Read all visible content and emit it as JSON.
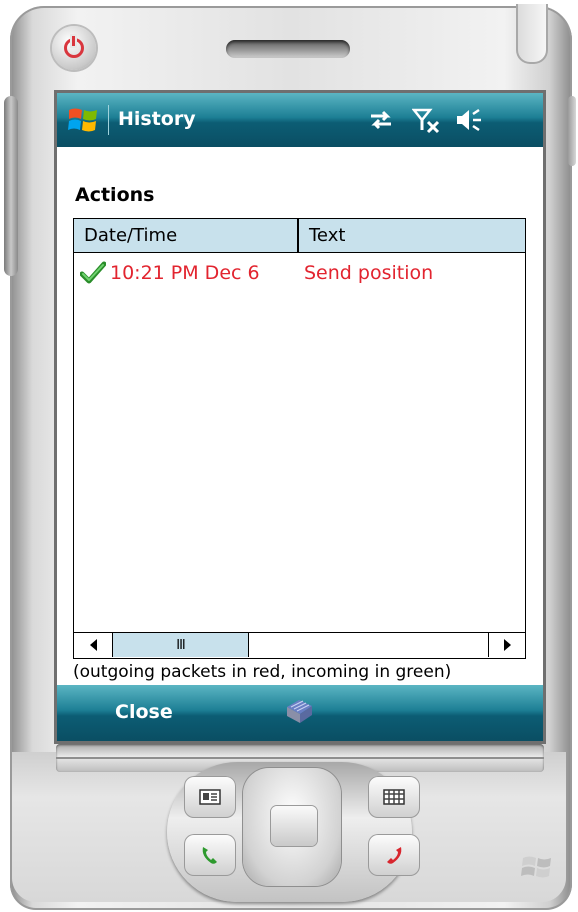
{
  "window": {
    "title": "History",
    "status_icons": [
      "sync-icon",
      "no-signal-icon",
      "speaker-icon"
    ]
  },
  "section": {
    "heading": "Actions"
  },
  "list": {
    "columns": [
      "Date/Time",
      "Text"
    ],
    "rows": [
      {
        "status": "check-icon",
        "datetime": "10:21 PM Dec 6",
        "text": "Send position",
        "color": "#e2242f"
      }
    ],
    "scrollbar": {
      "thumb_label": "III"
    }
  },
  "note": "(outgoing packets in red, incoming in green)",
  "softkeys": {
    "left": "Close",
    "center_icon": "keyboard-icon"
  },
  "colors": {
    "header_bg": "#c8e1ec",
    "titlebar": "#1d7f95",
    "outgoing": "#e2242f",
    "incoming": "#2ea02e"
  }
}
